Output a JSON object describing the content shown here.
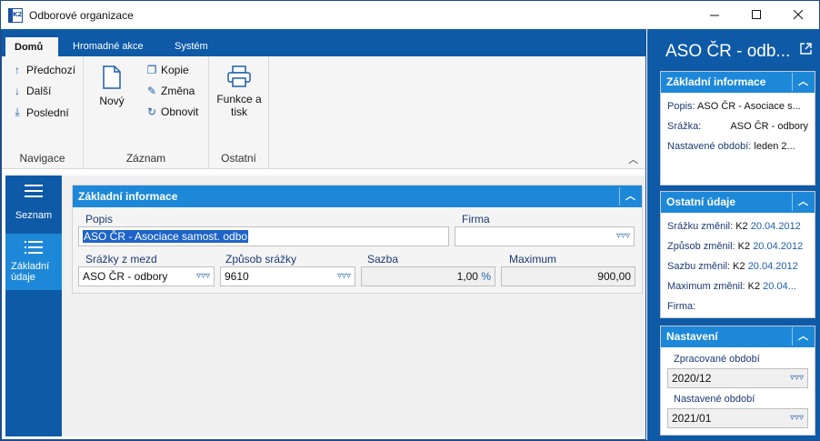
{
  "window": {
    "title": "Odborové organizace",
    "app_icon_text": "K2",
    "controls": [
      "minimize-icon",
      "maximize-icon",
      "close-icon"
    ]
  },
  "ribbon": {
    "tabs": [
      {
        "label": "Domů",
        "active": true
      },
      {
        "label": "Hromadné akce",
        "active": false
      },
      {
        "label": "Systém",
        "active": false
      }
    ],
    "groups": {
      "navigace": {
        "label": "Navigace",
        "items": [
          {
            "label": "Předchozí",
            "icon": "arrow-up-icon"
          },
          {
            "label": "Další",
            "icon": "arrow-down-icon"
          },
          {
            "label": "Poslední",
            "icon": "arrow-last-icon"
          }
        ]
      },
      "zaznam": {
        "label": "Záznam",
        "new_label": "Nový",
        "items": [
          {
            "label": "Kopie",
            "icon": "copy-icon"
          },
          {
            "label": "Změna",
            "icon": "pencil-icon"
          },
          {
            "label": "Obnovit",
            "icon": "refresh-icon"
          }
        ]
      },
      "ostatni": {
        "label": "Ostatní",
        "print_label_1": "Funkce a",
        "print_label_2": "tisk"
      }
    }
  },
  "leftnav": {
    "items": [
      {
        "label": "Seznam",
        "active": false
      },
      {
        "label_1": "Základní",
        "label_2": "údaje",
        "active": true
      }
    ]
  },
  "form": {
    "section_title": "Základní informace",
    "popis": {
      "label": "Popis",
      "value": "ASO ČR - Asociace samost. odbo"
    },
    "firma": {
      "label": "Firma",
      "value": ""
    },
    "srazky": {
      "label": "Srážky z mezd",
      "value": "ASO ČR - odbory"
    },
    "zpusob": {
      "label": "Způsob srážky",
      "value": "9610"
    },
    "sazba": {
      "label": "Sazba",
      "value": "1,00",
      "unit": "%"
    },
    "maximum": {
      "label": "Maximum",
      "value": "900,00"
    }
  },
  "rightpanel": {
    "title": "ASO ČR - odb...",
    "zakladni": {
      "title": "Základní informace",
      "rows": [
        {
          "label": "Popis:",
          "value": "ASO ČR - Asociace s..."
        },
        {
          "label": "Srážka:",
          "value": "ASO ČR - odbory"
        },
        {
          "label": "Nastavené období:",
          "value": "leden 2..."
        }
      ]
    },
    "ostatni": {
      "title": "Ostatní údaje",
      "rows": [
        {
          "label": "Srážku změnil:",
          "user": "K2",
          "date": "20.04.2012"
        },
        {
          "label": "Způsob změnil:",
          "user": "K2",
          "date": "20.04.2012"
        },
        {
          "label": "Sazbu změnil:",
          "user": "K2",
          "date": "20.04.2012"
        },
        {
          "label": "Maximum změnil:",
          "user": "K2",
          "date": "20.04..."
        },
        {
          "label": "Firma:",
          "user": "",
          "date": ""
        }
      ]
    },
    "nastaveni": {
      "title": "Nastavení",
      "zpracovane": {
        "label": "Zpracované období",
        "value": "2020/12"
      },
      "nastavene": {
        "label": "Nastavené období",
        "value": "2021/01"
      }
    }
  },
  "colors": {
    "brand_dark": "#0e5aa7",
    "brand_light": "#1e88d8",
    "selection": "#1e64c8"
  }
}
